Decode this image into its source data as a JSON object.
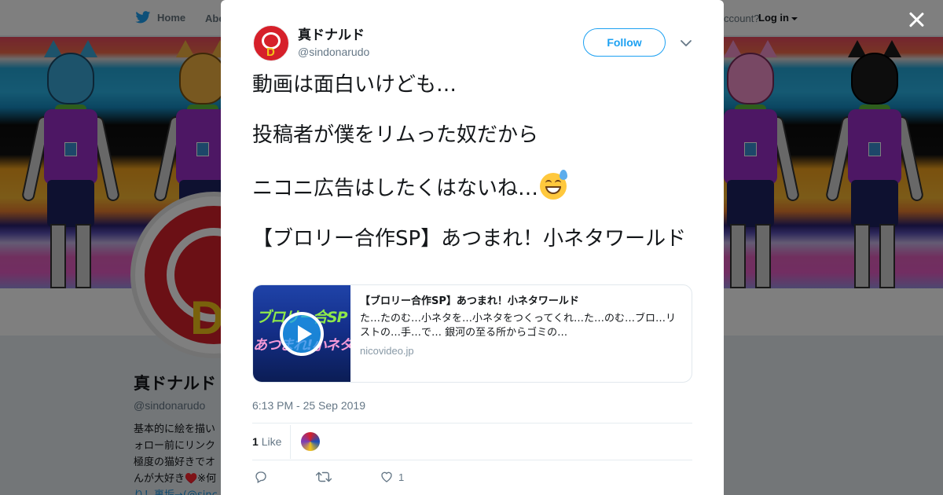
{
  "topnav": {
    "home_label": "Home",
    "about_label": "Abo",
    "account_prompt": "ccount?",
    "login_label": "Log in"
  },
  "profile": {
    "name": "真ドナルド",
    "handle": "@sindonarudo",
    "bio_lines": [
      "基本的に絵を描い",
      "ォロー前にリンク",
      "極度の猫好きでオ",
      "んが大好き♥️※何",
      "り！裏垢→(@sinc"
    ]
  },
  "tweet": {
    "author_name": "真ドナルド",
    "author_handle": "@sindonarudo",
    "follow_label": "Follow",
    "text_lines": [
      "動画は面白いけども…",
      "投稿者が僕をリムった奴だから",
      "ニコニ広告はしたくはないね…",
      "【ブロリー合作SP】あつまれ！小ネタワールド"
    ],
    "emoji_name": "grinning-face-with-sweat",
    "timestamp": "6:13 PM - 25 Sep 2019",
    "like_count": "1",
    "like_label": "Like",
    "like_action_count": "1"
  },
  "card": {
    "title": "【ブロリー合作SP】あつまれ！小ネタワールド",
    "description": "た…たのむ…小ネタを…小ネタをつくってくれ…た…のむ…ブロ…リストの…手…で… 銀河の至る所からゴミの…",
    "domain": "nicovideo.jp",
    "thumb_text_top": "ブロリー合SP",
    "thumb_text_bottom": "あつまれ!小ネタワール"
  },
  "colors": {
    "accent": "#1da1f2",
    "text": "#14171a",
    "muted": "#657786",
    "brand_red": "#d6202a",
    "brand_yellow": "#f2c318"
  },
  "icons": [
    "twitter-bird-icon",
    "close-icon",
    "chevron-down-icon",
    "play-icon",
    "reply-icon",
    "retweet-icon",
    "heart-icon"
  ]
}
